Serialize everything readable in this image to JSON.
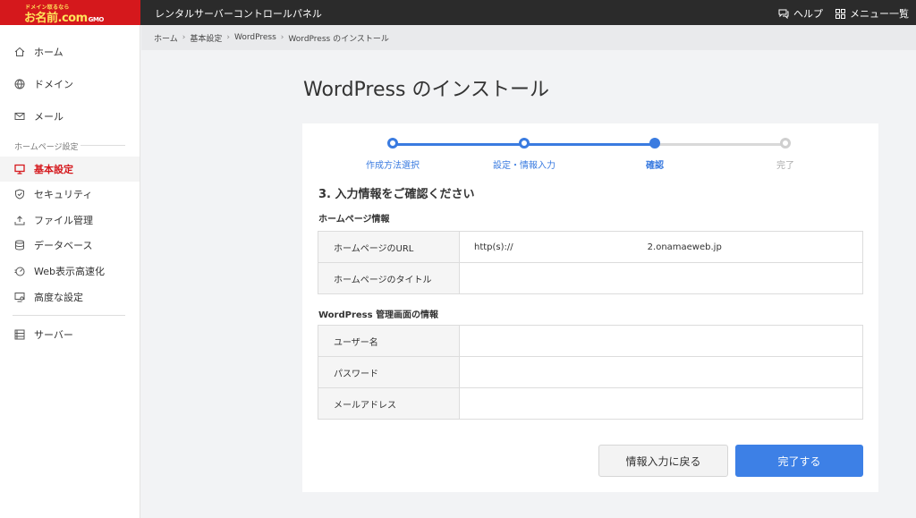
{
  "topbar": {
    "logo_tagline": "ドメイン取るなら",
    "logo_text": "お名前.com",
    "logo_suffix": "GMO",
    "app_title": "レンタルサーバーコントロールパネル",
    "help_label": "ヘルプ",
    "menu_label": "メニュー一覧"
  },
  "sidebar": {
    "items_top": [
      {
        "label": "ホーム",
        "icon": "home-icon"
      },
      {
        "label": "ドメイン",
        "icon": "globe-icon"
      },
      {
        "label": "メール",
        "icon": "mail-icon"
      }
    ],
    "section_label": "ホームページ設定",
    "items_hp": [
      {
        "label": "基本設定",
        "icon": "monitor-icon",
        "active": true
      },
      {
        "label": "セキュリティ",
        "icon": "shield-icon"
      },
      {
        "label": "ファイル管理",
        "icon": "upload-icon"
      },
      {
        "label": "データベース",
        "icon": "database-icon"
      },
      {
        "label": "Web表示高速化",
        "icon": "speed-icon"
      },
      {
        "label": "高度な設定",
        "icon": "settings-monitor-icon"
      }
    ],
    "items_bottom": [
      {
        "label": "サーバー",
        "icon": "server-icon"
      }
    ]
  },
  "breadcrumb": [
    "ホーム",
    "基本設定",
    "WordPress",
    "WordPress のインストール"
  ],
  "main": {
    "title": "WordPress のインストール",
    "steps": [
      {
        "label": "作成方法選択",
        "state": "done"
      },
      {
        "label": "設定・情報入力",
        "state": "done"
      },
      {
        "label": "確認",
        "state": "current"
      },
      {
        "label": "完了",
        "state": "inactive"
      }
    ],
    "section_heading": "3. 入力情報をご確認ください",
    "homepage_heading": "ホームページ情報",
    "homepage_rows": [
      {
        "key": "ホームページのURL",
        "value_prefix": "http(s)://",
        "value_suffix": "2.onamaeweb.jp"
      },
      {
        "key": "ホームページのタイトル",
        "value": ""
      }
    ],
    "admin_heading": "WordPress 管理画面の情報",
    "admin_rows": [
      {
        "key": "ユーザー名",
        "value": ""
      },
      {
        "key": "パスワード",
        "value": ""
      },
      {
        "key": "メールアドレス",
        "value": ""
      }
    ],
    "back_button": "情報入力に戻る",
    "done_button": "完了する"
  },
  "colors": {
    "brand_red": "#d5181c",
    "accent_blue": "#3a7be0",
    "topbar_bg": "#2b2b2b"
  }
}
